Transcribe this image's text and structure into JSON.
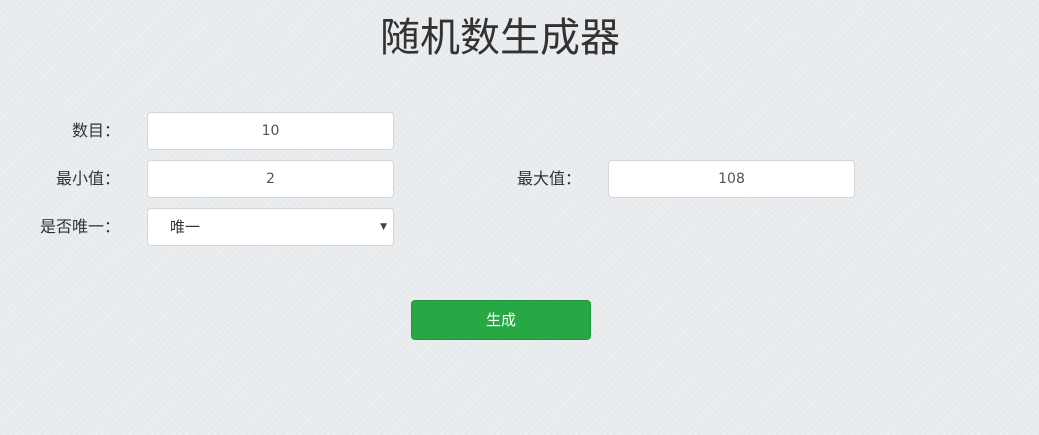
{
  "page": {
    "title": "随机数生成器"
  },
  "form": {
    "count": {
      "label": "数目：",
      "value": "10"
    },
    "min": {
      "label": "最小值：",
      "value": "2"
    },
    "max": {
      "label": "最大值：",
      "value": "108"
    },
    "unique": {
      "label": "是否唯一：",
      "selected": "唯一",
      "arrow_icon": "dropdown-triangle-icon"
    },
    "generate_button": "生成"
  },
  "colors": {
    "button_bg": "#28a745",
    "button_text": "#ffffff",
    "page_bg": "#e9ecee"
  }
}
